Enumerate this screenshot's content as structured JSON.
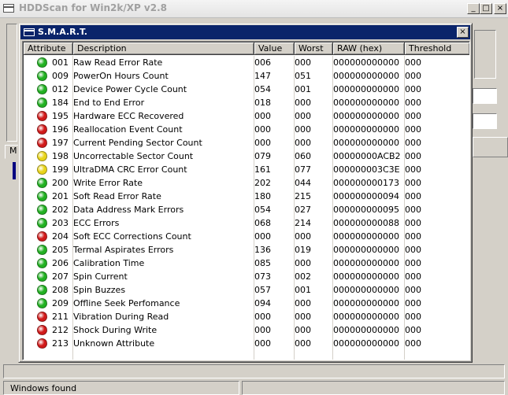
{
  "main_window": {
    "title": "HDDScan for Win2k/XP  v2.8",
    "buttons": {
      "minimize": "_",
      "maximize": "□",
      "close": "×"
    },
    "tab_label": "M",
    "status": "Windows found"
  },
  "smart_window": {
    "title": "S.M.A.R.T.",
    "close_glyph": "×",
    "columns": [
      "Attribute",
      "Description",
      "Value",
      "Worst",
      "RAW (hex)",
      "Threshold"
    ],
    "rows": [
      {
        "status": "green",
        "attribute": "001",
        "description": "Raw Read Error Rate",
        "value": "006",
        "worst": "000",
        "raw": "000000000000",
        "threshold": "000"
      },
      {
        "status": "green",
        "attribute": "009",
        "description": "PowerOn Hours Count",
        "value": "147",
        "worst": "051",
        "raw": "000000000000",
        "threshold": "000"
      },
      {
        "status": "green",
        "attribute": "012",
        "description": "Device Power Cycle Count",
        "value": "054",
        "worst": "001",
        "raw": "000000000000",
        "threshold": "000"
      },
      {
        "status": "green",
        "attribute": "184",
        "description": "End to End Error",
        "value": "018",
        "worst": "000",
        "raw": "000000000000",
        "threshold": "000"
      },
      {
        "status": "red",
        "attribute": "195",
        "description": "Hardware ECC Recovered",
        "value": "000",
        "worst": "000",
        "raw": "000000000000",
        "threshold": "000"
      },
      {
        "status": "red",
        "attribute": "196",
        "description": "Reallocation Event Count",
        "value": "000",
        "worst": "000",
        "raw": "000000000000",
        "threshold": "000"
      },
      {
        "status": "red",
        "attribute": "197",
        "description": "Current Pending Sector Count",
        "value": "000",
        "worst": "000",
        "raw": "000000000000",
        "threshold": "000"
      },
      {
        "status": "yellow",
        "attribute": "198",
        "description": "Uncorrectable Sector Count",
        "value": "079",
        "worst": "060",
        "raw": "00000000ACB2",
        "threshold": "000"
      },
      {
        "status": "yellow",
        "attribute": "199",
        "description": "UltraDMA CRC Error Count",
        "value": "161",
        "worst": "077",
        "raw": "000000003C3E",
        "threshold": "000"
      },
      {
        "status": "green",
        "attribute": "200",
        "description": "Write Error Rate",
        "value": "202",
        "worst": "044",
        "raw": "000000000173",
        "threshold": "000"
      },
      {
        "status": "green",
        "attribute": "201",
        "description": "Soft Read Error Rate",
        "value": "180",
        "worst": "215",
        "raw": "000000000094",
        "threshold": "000"
      },
      {
        "status": "green",
        "attribute": "202",
        "description": "Data Address Mark Errors",
        "value": "054",
        "worst": "027",
        "raw": "000000000095",
        "threshold": "000"
      },
      {
        "status": "green",
        "attribute": "203",
        "description": "ECC Errors",
        "value": "068",
        "worst": "214",
        "raw": "000000000088",
        "threshold": "000"
      },
      {
        "status": "red",
        "attribute": "204",
        "description": "Soft ECC Corrections Count",
        "value": "000",
        "worst": "000",
        "raw": "000000000000",
        "threshold": "000"
      },
      {
        "status": "green",
        "attribute": "205",
        "description": "Termal Aspirates Errors",
        "value": "136",
        "worst": "019",
        "raw": "000000000000",
        "threshold": "000"
      },
      {
        "status": "green",
        "attribute": "206",
        "description": "Calibration Time",
        "value": "085",
        "worst": "000",
        "raw": "000000000000",
        "threshold": "000"
      },
      {
        "status": "green",
        "attribute": "207",
        "description": "Spin Current",
        "value": "073",
        "worst": "002",
        "raw": "000000000000",
        "threshold": "000"
      },
      {
        "status": "green",
        "attribute": "208",
        "description": "Spin Buzzes",
        "value": "057",
        "worst": "001",
        "raw": "000000000000",
        "threshold": "000"
      },
      {
        "status": "green",
        "attribute": "209",
        "description": "Offline Seek Perfomance",
        "value": "094",
        "worst": "000",
        "raw": "000000000000",
        "threshold": "000"
      },
      {
        "status": "red",
        "attribute": "211",
        "description": "Vibration During Read",
        "value": "000",
        "worst": "000",
        "raw": "000000000000",
        "threshold": "000"
      },
      {
        "status": "red",
        "attribute": "212",
        "description": "Shock During Write",
        "value": "000",
        "worst": "000",
        "raw": "000000000000",
        "threshold": "000"
      },
      {
        "status": "red",
        "attribute": "213",
        "description": "Unknown Attribute",
        "value": "000",
        "worst": "000",
        "raw": "000000000000",
        "threshold": "000"
      }
    ]
  },
  "colors": {
    "green": "#22b122",
    "red": "#d11a1a",
    "yellow": "#e8d41a",
    "titlebar_active": "#0a246a"
  }
}
